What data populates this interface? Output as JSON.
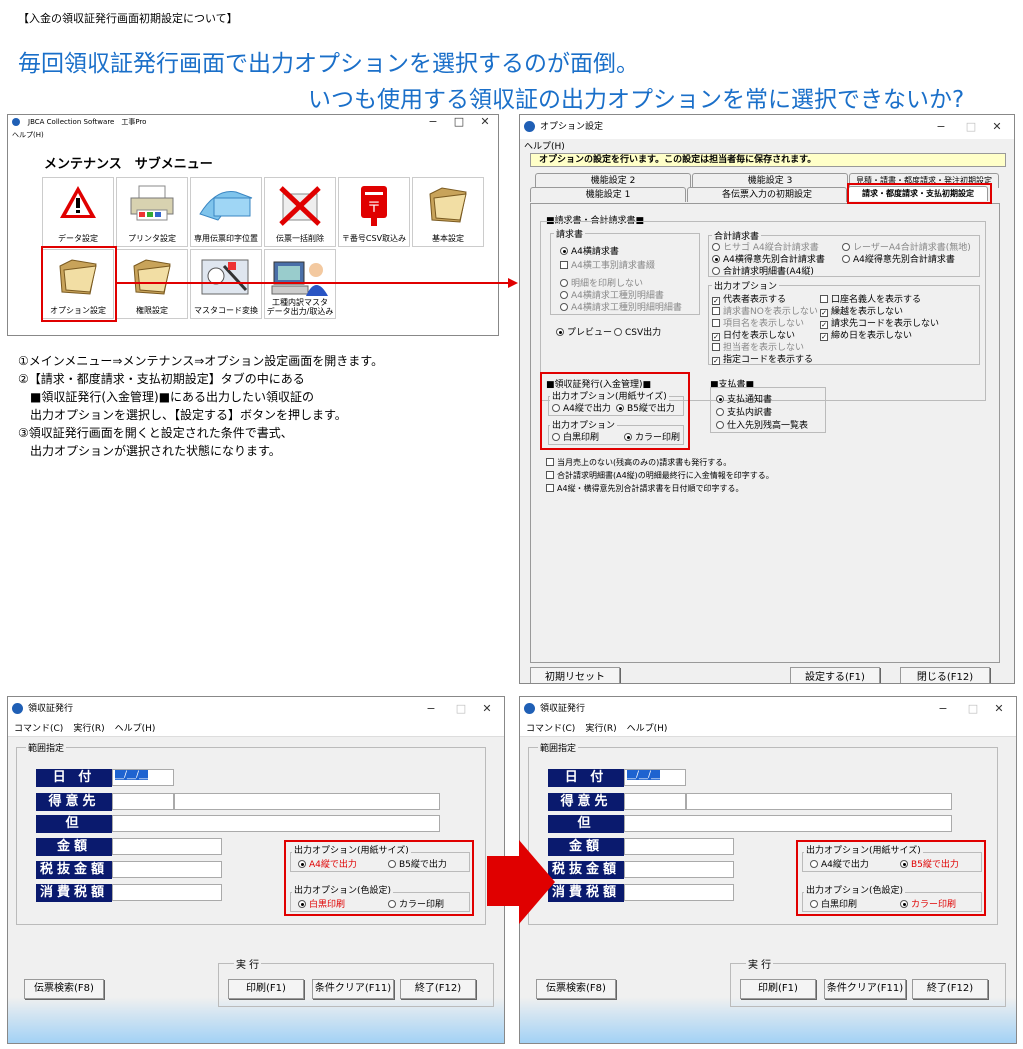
{
  "header": {
    "top_note": "【入金の領収証発行画面初期設定について】",
    "headline1": "毎回領収証発行画面で出力オプションを選択するのが面倒。",
    "headline2": "いつも使用する領収証の出力オプションを常に選択できないか?"
  },
  "colors": {
    "headline": "#1a6fc9",
    "highlight": "#e00000",
    "navy": "#0a1a6e"
  },
  "main_window": {
    "title": "JBCA Collection Software　工事Pro",
    "menu": "ヘルプ(H)",
    "heading": "メンテナンス　サブメニュー",
    "icons": [
      {
        "label": "データ設定",
        "icon": "warning-icon"
      },
      {
        "label": "プリンタ設定",
        "icon": "printer-icon"
      },
      {
        "label": "専用伝票印字位置",
        "icon": "forms-icon"
      },
      {
        "label": "伝票一括削除",
        "icon": "delete-x-icon"
      },
      {
        "label": "〒番号CSV取込み",
        "icon": "postbox-icon"
      },
      {
        "label": "基本設定",
        "icon": "folder-icon"
      },
      {
        "label": "オプション設定",
        "icon": "folder-icon"
      },
      {
        "label": "権限設定",
        "icon": "folder-icon"
      },
      {
        "label": "マスタコード変換",
        "icon": "tools-icon"
      },
      {
        "label": "工種内訳マスタ",
        "label2": "データ出力/取込み",
        "icon": "computer-user-icon"
      }
    ]
  },
  "instructions": [
    "①メインメニュー⇒メンテナンス⇒オプション設定画面を開きます。",
    "②【請求・都度請求・支払初期設定】タブの中にある",
    "　■領収証発行(入金管理)■にある出力したい領収証の",
    "　出力オプションを選択し、【設定する】ボタンを押します。",
    "③領収証発行画面を開くと設定された条件で書式、",
    "　出力オプションが選択された状態になります。"
  ],
  "options_window": {
    "title": "オプション設定",
    "menu": "ヘルプ(H)",
    "notice": "オプションの設定を行います。この設定は担当者毎に保存されます。",
    "tabs_row1": [
      "機能設定 2",
      "機能設定 3",
      "見積・請書・都度請求・発注初期設定"
    ],
    "tabs_row2": [
      "機能設定 1",
      "各伝票入力の初期設定",
      "請求・都度請求・支払初期設定"
    ],
    "group_main": "■請求書・合計請求書■",
    "seikyusho": {
      "title": "請求書",
      "items": [
        "A4横請求書",
        "A4横工事別請求書綴",
        "明細を印刷しない",
        "A4横請求工種別明細書",
        "A4横請求工種別明細明細書"
      ]
    },
    "gokei": {
      "title": "合計請求書",
      "items": [
        "ヒサゴ A4縦合計請求書",
        "レーザーA4合計請求書(無地)",
        "A4横得意先別合計請求書",
        "A4縦得意先別合計請求書",
        "合計請求明細書(A4縦)"
      ]
    },
    "output_opts": {
      "title": "出力オプション",
      "left": [
        "代表者表示する",
        "請求書NOを表示しない",
        "項目名を表示しない",
        "日付を表示しない",
        "担当者を表示しない",
        "指定コードを表示する"
      ],
      "right": [
        "口座名義人を表示する",
        "繰越を表示しない",
        "請求先コードを表示しない",
        "締め日を表示しない"
      ]
    },
    "preview": "プレビュー",
    "csv": "CSV出力",
    "ryoshu": {
      "title": "■領収証発行(入金管理)■",
      "size_title": "出力オプション(用紙サイズ)",
      "size_a4": "A4縦で出力",
      "size_b5": "B5縦で出力",
      "color_title": "出力オプション",
      "mono": "白黒印刷",
      "color": "カラー印刷"
    },
    "shiharai": {
      "title": "■支払書■",
      "items": [
        "支払通知書",
        "支払内訳書",
        "仕入先別残高一覧表"
      ]
    },
    "checks": [
      "当月売上のない(残高のみの)請求書も発行する。",
      "合計請求明細書(A4縦)の明細最終行に入金情報を印字する。",
      "A4縦・横得意先別合計請求書を日付順で印字する。"
    ],
    "buttons": [
      "初期リセット",
      "設定する(F1)",
      "閉じる(F12)"
    ]
  },
  "receipt_windows": [
    {
      "title": "領収証発行",
      "menu": [
        "コマンド(C)",
        "実行(R)",
        "ヘルプ(H)"
      ],
      "range": "範囲指定",
      "fields": [
        "日 付",
        "得意先",
        "但",
        "金額",
        "税抜金額",
        "消費税額"
      ],
      "date_value": "__/__/__",
      "size_title": "出力オプション(用紙サイズ)",
      "size_a4": "A4縦で出力",
      "size_b5": "B5縦で出力",
      "color_title": "出力オプション(色設定)",
      "mono": "白黒印刷",
      "color": "カラー印刷",
      "exec": "実 行",
      "buttons": [
        "伝票検索(F8)",
        "印刷(F1)",
        "条件クリア(F11)",
        "終了(F12)"
      ],
      "selected_size": "A4",
      "selected_color": "mono"
    },
    {
      "title": "領収証発行",
      "menu": [
        "コマンド(C)",
        "実行(R)",
        "ヘルプ(H)"
      ],
      "range": "範囲指定",
      "fields": [
        "日 付",
        "得意先",
        "但",
        "金額",
        "税抜金額",
        "消費税額"
      ],
      "date_value": "__/__/__",
      "size_title": "出力オプション(用紙サイズ)",
      "size_a4": "A4縦で出力",
      "size_b5": "B5縦で出力",
      "color_title": "出力オプション(色設定)",
      "mono": "白黒印刷",
      "color": "カラー印刷",
      "exec": "実 行",
      "buttons": [
        "伝票検索(F8)",
        "印刷(F1)",
        "条件クリア(F11)",
        "終了(F12)"
      ],
      "selected_size": "B5",
      "selected_color": "color"
    }
  ]
}
